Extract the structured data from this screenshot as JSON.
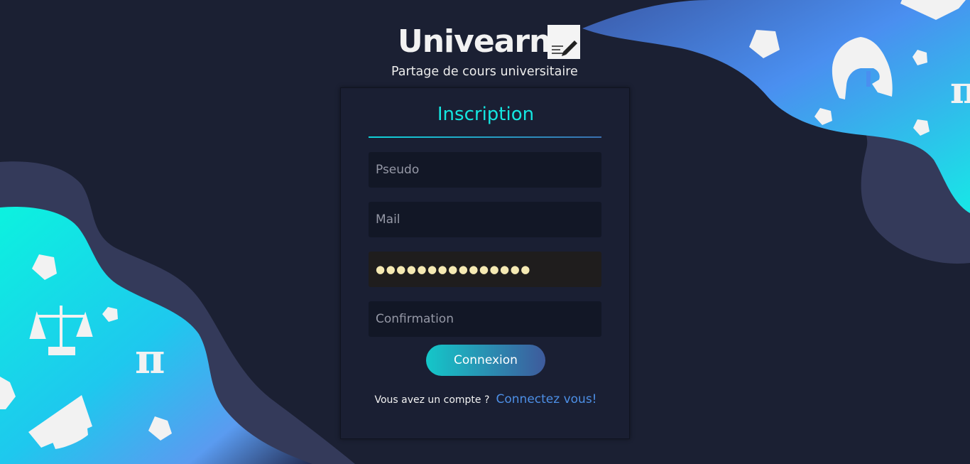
{
  "brand": {
    "name": "Univearn",
    "tagline": "Partage de cours universitaire"
  },
  "form": {
    "title": "Inscription",
    "pseudo_placeholder": "Pseudo",
    "mail_placeholder": "Mail",
    "password_value": "●●●●●●●●●●●●●●●",
    "confirmation_placeholder": "Confirmation",
    "submit_label": "Connexion",
    "account_question": "Vous avez un compte ?",
    "login_link": "Connectez vous!"
  },
  "decor": {
    "icons": [
      "pentagon-icon",
      "helmet-icon",
      "pi-icon",
      "scales-icon",
      "graduation-cap-icon"
    ]
  },
  "colors": {
    "background": "#1b2033",
    "card": "#1a1f33",
    "accent_cyan": "#14e6e0",
    "link_blue": "#4d8fe6",
    "blob_cyan": "#0df0e0",
    "blob_blue": "#5a9bf0"
  }
}
